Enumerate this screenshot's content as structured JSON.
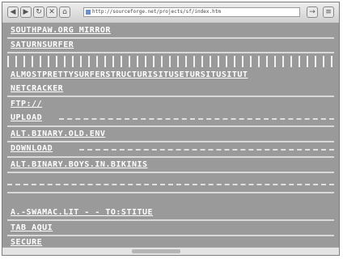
{
  "browser": {
    "url": "http://sourceforge.net/projects/sf/index.htm",
    "icons": [
      "back-icon",
      "forward-icon",
      "reload-icon",
      "stop-icon",
      "home-icon",
      "page-icon"
    ]
  },
  "lines": [
    "SOUTHPAW.ORG MIRROR",
    "SATURNSURFER",
    "ALMOSTPRETTYSURFERSTRUCTURISITUSETURSITUSITUT",
    "NETCRACKER",
    "FTP://",
    "UPLOAD",
    "ALT.BINARY.OLD.ENV",
    "DOWNLOAD",
    "ALT.BINARY.BOYS.IN.BIKINIS",
    "A.-SWAMAC.LIT - - TO:STITUE",
    "TAB AQUI",
    "SECURE"
  ]
}
